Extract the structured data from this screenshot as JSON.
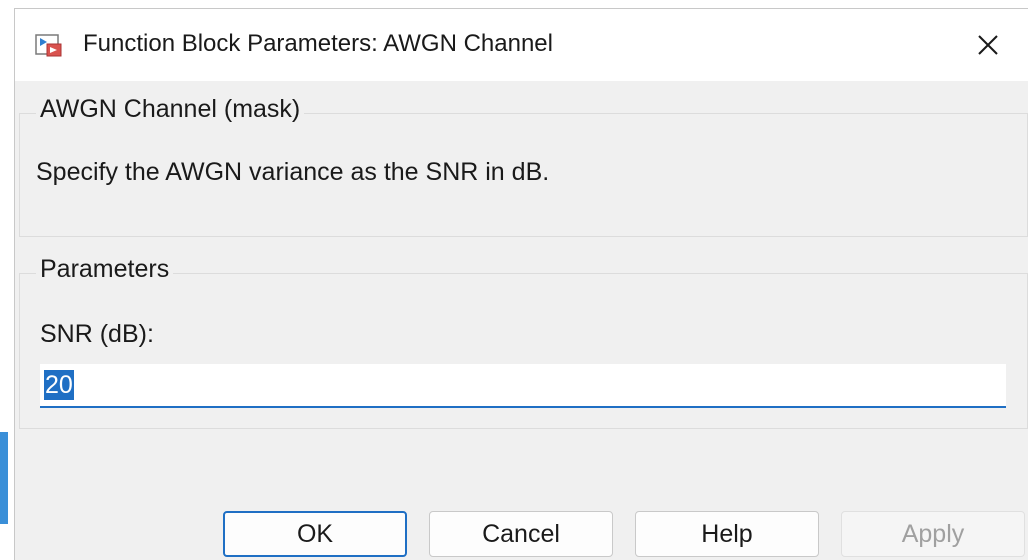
{
  "window": {
    "title": "Function Block Parameters: AWGN Channel"
  },
  "description_group": {
    "legend": "AWGN Channel (mask)",
    "text": "Specify the AWGN variance as the SNR in dB."
  },
  "parameters_group": {
    "legend": "Parameters",
    "snr_label": "SNR (dB):",
    "snr_value": "20"
  },
  "buttons": {
    "ok": "OK",
    "cancel": "Cancel",
    "help": "Help",
    "apply": "Apply"
  },
  "icons": {
    "app": "simulink-block-icon",
    "close": "close-icon"
  },
  "colors": {
    "accent": "#1f6fc4",
    "dialog_bg": "#f0f0f0",
    "disabled_text": "#a0a0a0"
  }
}
